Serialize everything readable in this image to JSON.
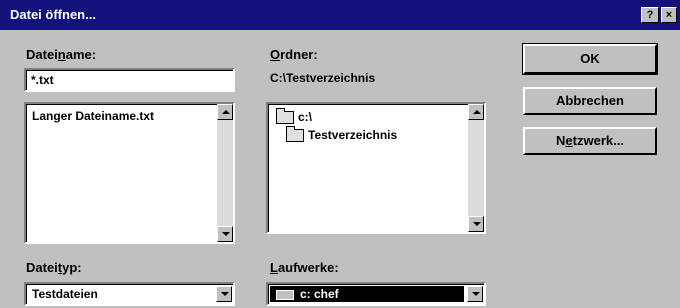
{
  "window": {
    "title": "Datei öffnen...",
    "help_btn": "?",
    "close_btn": "×"
  },
  "filename": {
    "label_pre": "Datei",
    "label_access": "n",
    "label_post": "ame:",
    "value": "*.txt",
    "files": [
      "Langer Dateiname.txt"
    ]
  },
  "folders": {
    "label_access": "O",
    "label_post": "rdner:",
    "path": "C:\\Testverzeichnis",
    "items": [
      "c:\\",
      "Testverzeichnis"
    ]
  },
  "filetype": {
    "label_pre": "Datei",
    "label_access": "t",
    "label_post": "yp:",
    "value": "Testdateien"
  },
  "drives": {
    "label_access": "L",
    "label_post": "aufwerke:",
    "value": "c: chef"
  },
  "buttons": {
    "ok": "OK",
    "cancel": "Abbrechen",
    "network_pre": "N",
    "network_access": "e",
    "network_post": "tzwerk..."
  },
  "colors": {
    "titlebar": "#12127a",
    "dialog": "#c0c0c0",
    "selection": "#000000"
  }
}
